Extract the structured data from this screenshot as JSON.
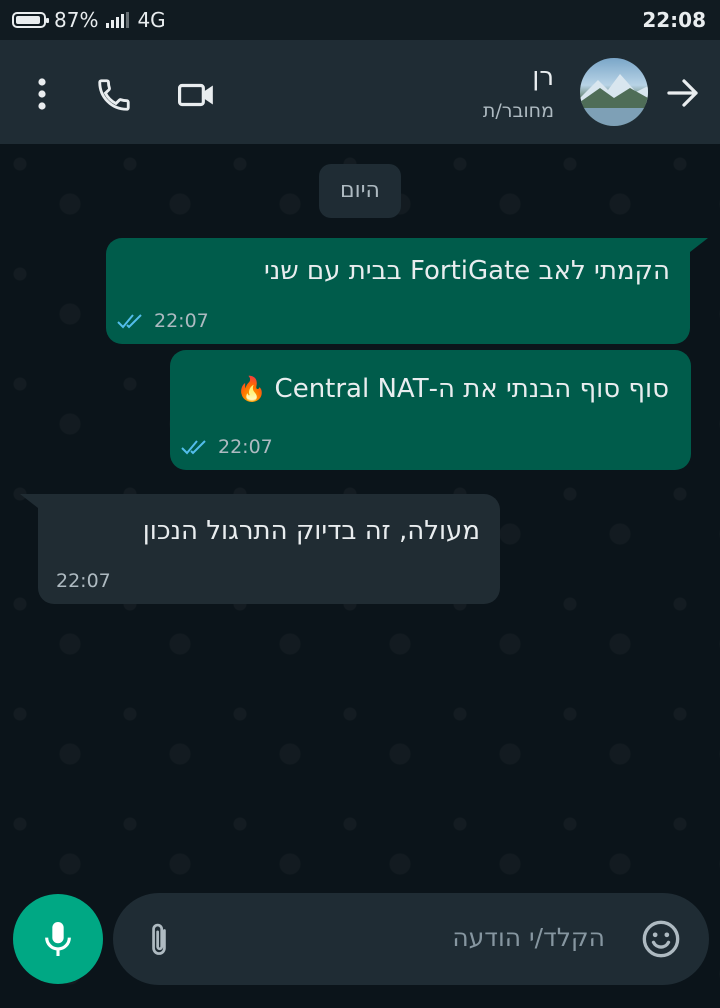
{
  "status_bar": {
    "battery": "87%",
    "battery_level": 0.87,
    "network": "4G",
    "time": "22:08"
  },
  "header": {
    "contact_name": "רן",
    "contact_status": "מחובר/ת"
  },
  "chat": {
    "date_label": "היום",
    "messages": [
      {
        "direction": "outgoing",
        "text": "הקמתי לאב FortiGate בבית עם שני",
        "time": "22:07",
        "status": "read"
      },
      {
        "direction": "outgoing",
        "text": "סוף סוף הבנתי את ה-Central NAT",
        "emoji": "🔥",
        "time": "22:07",
        "status": "read"
      },
      {
        "direction": "incoming",
        "text": "מעולה, זה בדיוק התרגול הנכון",
        "time": "22:07"
      }
    ]
  },
  "composer": {
    "placeholder": "הקלד/י הודעה"
  },
  "colors": {
    "accent": "#00a884",
    "outgoing_bubble": "#005c4b",
    "incoming_bubble": "#202c33",
    "read_ticks": "#53bdeb"
  }
}
